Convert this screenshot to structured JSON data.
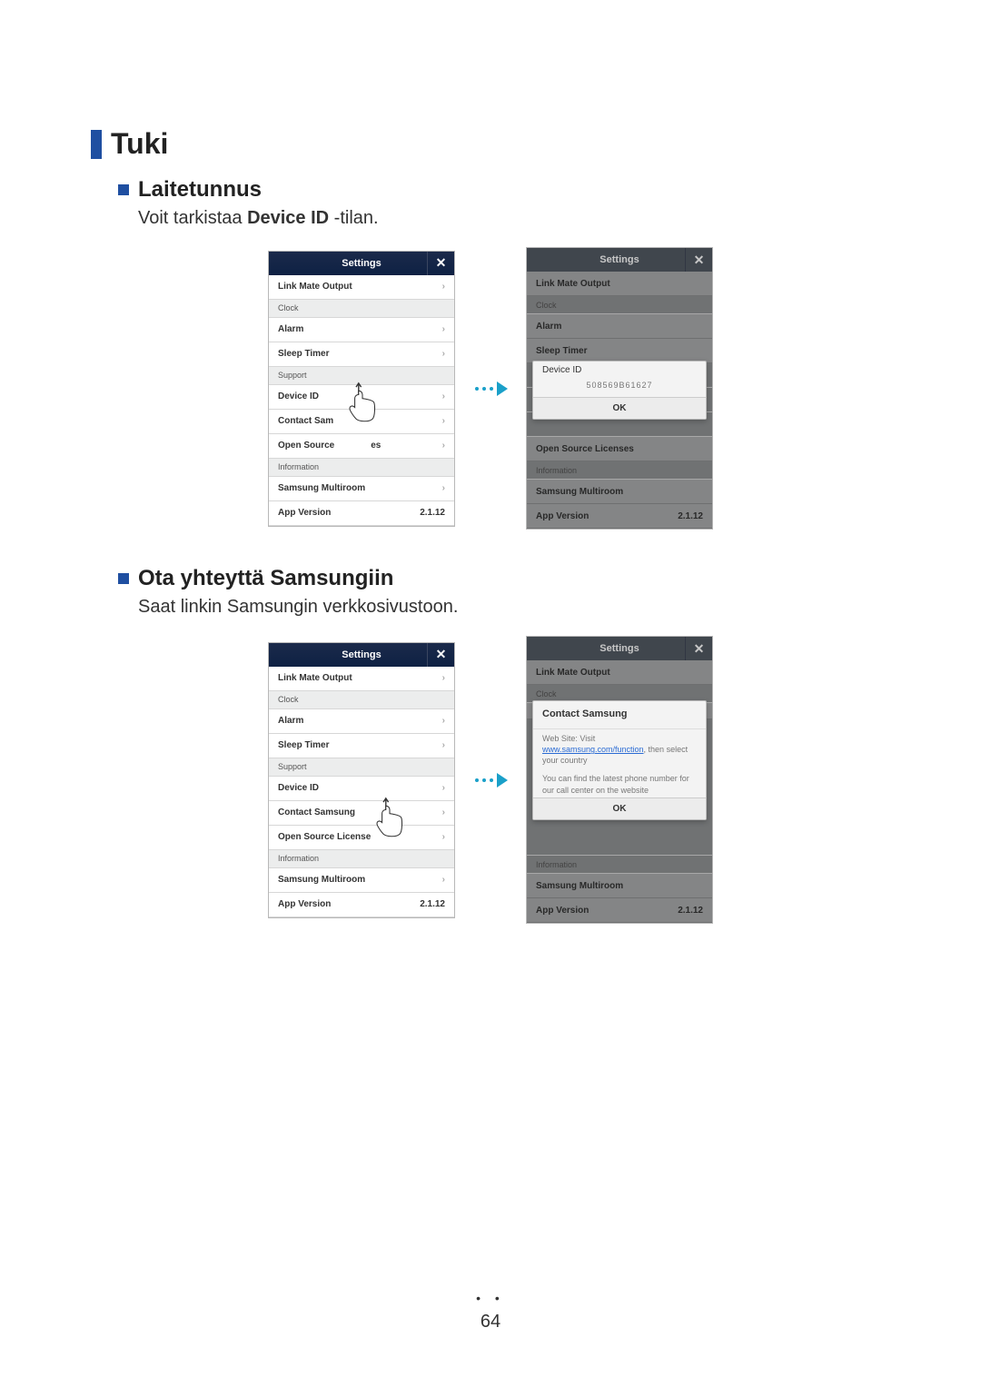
{
  "page_number": "64",
  "headings": {
    "h1": "Tuki",
    "h2a": "Laitetunnus",
    "body_a_pre": "Voit tarkistaa ",
    "body_a_bold": "Device ID",
    "body_a_post": " -tilan.",
    "h2b": "Ota yhteyttä Samsungiin",
    "body_b": "Saat linkin Samsungin verkkosivustoon."
  },
  "settings_title": "Settings",
  "rows": {
    "link_mate": "Link Mate Output",
    "clock": "Clock",
    "alarm": "Alarm",
    "sleep_timer": "Sleep Timer",
    "support": "Support",
    "device_id": "Device ID",
    "contact_trunc": "Contact Sam",
    "contact_full": "Contact Samsung",
    "osl_trunc_pre": "Open Source",
    "osl_trunc_post": "es",
    "osl_full": "Open Source Licenses",
    "osl_cut": "Open Source License",
    "information": "Information",
    "multiroom": "Samsung Multiroom",
    "app_version": "App Version",
    "app_version_val": "2.1.12"
  },
  "popup_device": {
    "title": "Device ID",
    "id": "508569B61627",
    "ok": "OK"
  },
  "popup_contact": {
    "title": "Contact Samsung",
    "line1_pre": "Web Site: Visit",
    "link": "www.samsung.com/function",
    "line1_post": ", then select your country",
    "line2": "You can find the latest phone number for our call center on the website",
    "ok": "OK"
  }
}
